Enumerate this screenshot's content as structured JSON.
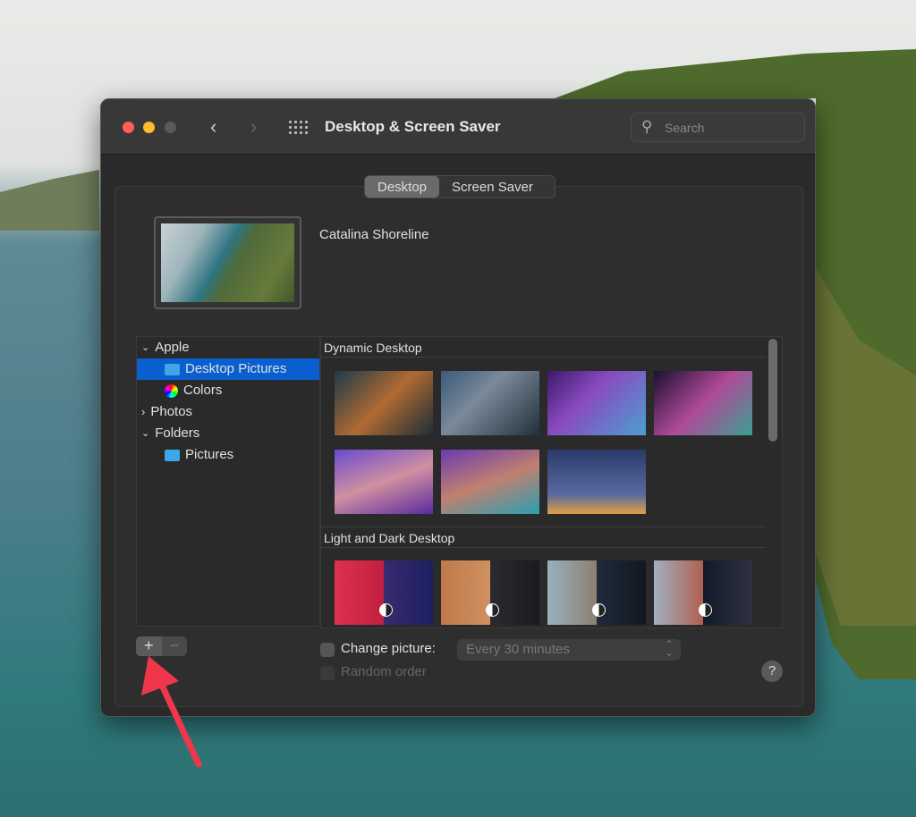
{
  "window": {
    "title": "Desktop & Screen Saver",
    "search_placeholder": "Search"
  },
  "tabs": [
    {
      "label": "Desktop",
      "selected": true
    },
    {
      "label": "Screen Saver",
      "selected": false
    }
  ],
  "current_picture": "Catalina Shoreline",
  "sidebar": {
    "items": [
      {
        "label": "Apple",
        "type": "group",
        "expanded": true
      },
      {
        "label": "Desktop Pictures",
        "type": "folder",
        "selected": true
      },
      {
        "label": "Colors",
        "type": "colors"
      },
      {
        "label": "Photos",
        "type": "group",
        "expanded": false
      },
      {
        "label": "Folders",
        "type": "group",
        "expanded": true
      },
      {
        "label": "Pictures",
        "type": "folder"
      }
    ]
  },
  "sections": [
    {
      "title": "Dynamic Desktop"
    },
    {
      "title": "Light and Dark Desktop"
    }
  ],
  "controls": {
    "add": "+",
    "remove": "−",
    "change_picture": "Change picture:",
    "interval": "Every 30 minutes",
    "random_order": "Random order",
    "help": "?"
  },
  "colors": {
    "accent": "#0a5fd0",
    "annotation_arrow": "#f0364a"
  }
}
